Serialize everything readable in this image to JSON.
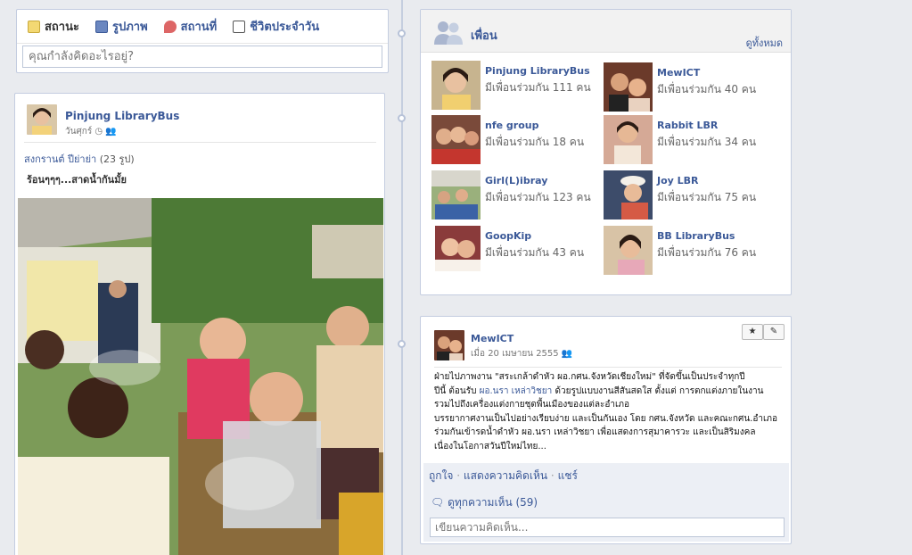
{
  "colors": {
    "link": "#3b5998",
    "timeline": "#c5cedf",
    "background": "#e9ebef"
  },
  "composer": {
    "tabs": [
      {
        "label": "สถานะ",
        "icon": "status-icon"
      },
      {
        "label": "รูปภาพ",
        "icon": "photo-icon"
      },
      {
        "label": "สถานที่",
        "icon": "place-icon"
      },
      {
        "label": "ชีวิตประจำวัน",
        "icon": "life-event-icon"
      }
    ],
    "placeholder": "คุณกำลังคิดอะไรอยู่?"
  },
  "post_left": {
    "author": "Pinjung LibraryBus",
    "date": "วันศุกร์",
    "album_name": "สงกรานต์",
    "album_owner": "ปีย่าย่า",
    "album_count": "(23 รูป)",
    "caption": "ร้อนๆๆๆ...สาดน้ำกันมั้ย"
  },
  "friends": {
    "title": "เพื่อน",
    "see_all": "ดูทั้งหมด",
    "items": [
      {
        "name": "Pinjung LibraryBus",
        "mutual": "มีเพื่อนร่วมกัน 111 คน"
      },
      {
        "name": "MewICT",
        "mutual": "มีเพื่อนร่วมกัน 40 คน"
      },
      {
        "name": "nfe group",
        "mutual": "มีเพื่อนร่วมกัน 18 คน"
      },
      {
        "name": "Rabbit LBR",
        "mutual": "มีเพื่อนร่วมกัน 34 คน"
      },
      {
        "name": "Girl(L)ibray",
        "mutual": "มีเพื่อนร่วมกัน 123 คน"
      },
      {
        "name": "Joy LBR",
        "mutual": "มีเพื่อนร่วมกัน 75 คน"
      },
      {
        "name": "GoopKip",
        "mutual": "มีเพื่อนร่วมกัน 43 คน"
      },
      {
        "name": "BB LibraryBus",
        "mutual": "มีเพื่อนร่วมกัน 76 คน"
      }
    ]
  },
  "post_right": {
    "author": "MewICT",
    "date": "เมื่อ 20 เมษายน 2555",
    "star_label": "★",
    "edit_label": "✎",
    "line1": "ฝ่ายไปภาพงาน \"สระเกล้าดำหัว ผอ.กศน.จังหวัดเชียงใหม่\" ที่จัดขึ้นเป็นประจำทุกปี",
    "line2a": "ปีนี้ ต้อนรับ ",
    "line2b": "ผอ.นรา เหล่าวิชยา",
    "line2c": " ด้วยรูปแบบงานสีสันสดใส ตั้งแต่ การตกแต่งภายในงาน",
    "line3": "รวมไปถึงเครื่องแต่งกายชุดพื้นเมืองของแต่ละอำเภอ",
    "line4": "บรรยากาศงานเป็นไปอย่างเรียบง่าย และเป็นกันเอง โดย กศน.จังหวัด และคณะกศน.อำเภอ",
    "line5": "ร่วมกันเข้ารดน้ำดำหัว ผอ.นรา เหล่าวิชยา เพื่อแสดงการสุมาคารวะ และเป็นสิริมงคล",
    "line6": "เนื่องในโอกาสวันปีใหม่ไทย...",
    "like": "ถูกใจ",
    "comment": "แสดงความคิดเห็น",
    "share": "แชร์",
    "dot": "·",
    "view_comments": "ดูทุกความเห็น (59)",
    "comment_placeholder": "เขียนความคิดเห็น..."
  }
}
